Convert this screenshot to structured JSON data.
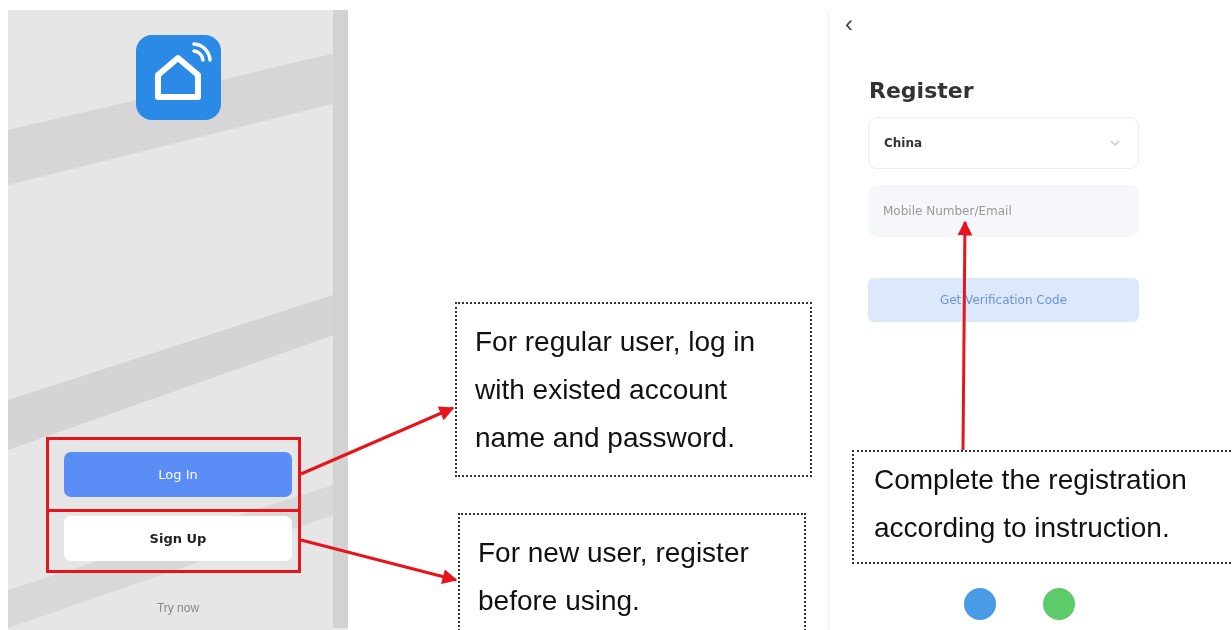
{
  "login_screen": {
    "buttons": [
      {
        "label": "Log In",
        "kind": "primary"
      },
      {
        "label": "Sign Up",
        "kind": "secondary"
      }
    ],
    "try_now": "Try now"
  },
  "register_screen": {
    "back": "‹",
    "title": "Register",
    "region": "China",
    "contact_field": {
      "placeholder": "Mobile Number/Email"
    },
    "submit": {
      "label": "Get Verification Code",
      "disabled": true
    }
  },
  "callouts": [
    {
      "text": "For regular user, log in with existed account name and password."
    },
    {
      "text": "For new user, register before using."
    },
    {
      "text": "Complete the registration according to instruction."
    }
  ]
}
